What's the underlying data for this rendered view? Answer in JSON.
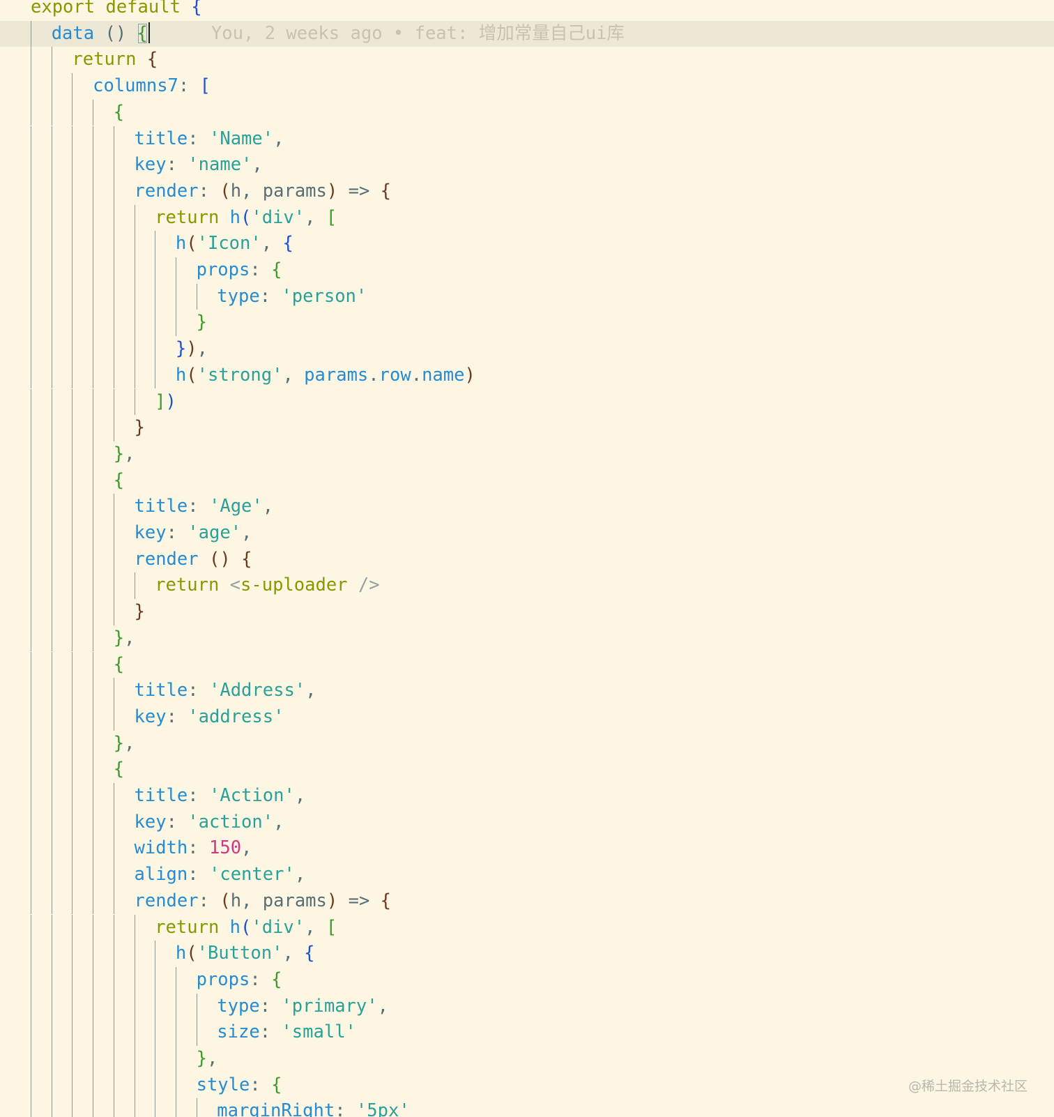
{
  "editor": {
    "current_line_index": 1,
    "lines": [
      {
        "indent": 0,
        "tokens": [
          {
            "t": "export default ",
            "c": "kw"
          },
          {
            "t": "{",
            "c": "b1"
          }
        ]
      },
      {
        "indent": 1,
        "tokens": [
          {
            "t": "data",
            "c": "prop"
          },
          {
            "t": " ",
            "c": "plain"
          },
          {
            "t": "()",
            "c": "paren"
          },
          {
            "t": " ",
            "c": "plain"
          },
          {
            "t": "{",
            "c": "b2",
            "hl": true
          }
        ],
        "cursor": true,
        "blame": "You, 2 weeks ago • feat: 增加常量自己ui库"
      },
      {
        "indent": 2,
        "tokens": [
          {
            "t": "return ",
            "c": "kw"
          },
          {
            "t": "{",
            "c": "b3"
          }
        ]
      },
      {
        "indent": 3,
        "tokens": [
          {
            "t": "columns7",
            "c": "prop"
          },
          {
            "t": ": ",
            "c": "plain"
          },
          {
            "t": "[",
            "c": "b1"
          }
        ]
      },
      {
        "indent": 4,
        "tokens": [
          {
            "t": "{",
            "c": "b2"
          }
        ]
      },
      {
        "indent": 5,
        "tokens": [
          {
            "t": "title",
            "c": "prop"
          },
          {
            "t": ": ",
            "c": "plain"
          },
          {
            "t": "'Name'",
            "c": "str"
          },
          {
            "t": ",",
            "c": "plain"
          }
        ]
      },
      {
        "indent": 5,
        "tokens": [
          {
            "t": "key",
            "c": "prop"
          },
          {
            "t": ": ",
            "c": "plain"
          },
          {
            "t": "'name'",
            "c": "str"
          },
          {
            "t": ",",
            "c": "plain"
          }
        ]
      },
      {
        "indent": 5,
        "tokens": [
          {
            "t": "render",
            "c": "prop"
          },
          {
            "t": ": ",
            "c": "plain"
          },
          {
            "t": "(",
            "c": "b3"
          },
          {
            "t": "h, params",
            "c": "plain"
          },
          {
            "t": ")",
            "c": "b3"
          },
          {
            "t": " => ",
            "c": "plain"
          },
          {
            "t": "{",
            "c": "b3"
          }
        ]
      },
      {
        "indent": 6,
        "tokens": [
          {
            "t": "return ",
            "c": "kw"
          },
          {
            "t": "h",
            "c": "prop"
          },
          {
            "t": "(",
            "c": "b1"
          },
          {
            "t": "'div'",
            "c": "str"
          },
          {
            "t": ", ",
            "c": "plain"
          },
          {
            "t": "[",
            "c": "b2"
          }
        ]
      },
      {
        "indent": 7,
        "tokens": [
          {
            "t": "h",
            "c": "prop"
          },
          {
            "t": "(",
            "c": "b3"
          },
          {
            "t": "'Icon'",
            "c": "str"
          },
          {
            "t": ", ",
            "c": "plain"
          },
          {
            "t": "{",
            "c": "b1"
          }
        ]
      },
      {
        "indent": 8,
        "tokens": [
          {
            "t": "props",
            "c": "prop"
          },
          {
            "t": ": ",
            "c": "plain"
          },
          {
            "t": "{",
            "c": "b2"
          }
        ]
      },
      {
        "indent": 9,
        "tokens": [
          {
            "t": "type",
            "c": "prop"
          },
          {
            "t": ": ",
            "c": "plain"
          },
          {
            "t": "'person'",
            "c": "str"
          }
        ]
      },
      {
        "indent": 8,
        "tokens": [
          {
            "t": "}",
            "c": "b2"
          }
        ]
      },
      {
        "indent": 7,
        "tokens": [
          {
            "t": "}",
            "c": "b1"
          },
          {
            "t": ")",
            "c": "b3"
          },
          {
            "t": ",",
            "c": "plain"
          }
        ]
      },
      {
        "indent": 7,
        "tokens": [
          {
            "t": "h",
            "c": "prop"
          },
          {
            "t": "(",
            "c": "b3"
          },
          {
            "t": "'strong'",
            "c": "str"
          },
          {
            "t": ", ",
            "c": "plain"
          },
          {
            "t": "params",
            "c": "prop"
          },
          {
            "t": ".",
            "c": "plain"
          },
          {
            "t": "row",
            "c": "prop"
          },
          {
            "t": ".",
            "c": "plain"
          },
          {
            "t": "name",
            "c": "prop"
          },
          {
            "t": ")",
            "c": "b3"
          }
        ]
      },
      {
        "indent": 6,
        "tokens": [
          {
            "t": "]",
            "c": "b2"
          },
          {
            "t": ")",
            "c": "b1"
          }
        ]
      },
      {
        "indent": 5,
        "tokens": [
          {
            "t": "}",
            "c": "b3"
          }
        ]
      },
      {
        "indent": 4,
        "tokens": [
          {
            "t": "}",
            "c": "b2"
          },
          {
            "t": ",",
            "c": "plain"
          }
        ]
      },
      {
        "indent": 4,
        "tokens": [
          {
            "t": "{",
            "c": "b2"
          }
        ]
      },
      {
        "indent": 5,
        "tokens": [
          {
            "t": "title",
            "c": "prop"
          },
          {
            "t": ": ",
            "c": "plain"
          },
          {
            "t": "'Age'",
            "c": "str"
          },
          {
            "t": ",",
            "c": "plain"
          }
        ]
      },
      {
        "indent": 5,
        "tokens": [
          {
            "t": "key",
            "c": "prop"
          },
          {
            "t": ": ",
            "c": "plain"
          },
          {
            "t": "'age'",
            "c": "str"
          },
          {
            "t": ",",
            "c": "plain"
          }
        ]
      },
      {
        "indent": 5,
        "tokens": [
          {
            "t": "render",
            "c": "prop"
          },
          {
            "t": " ",
            "c": "plain"
          },
          {
            "t": "()",
            "c": "b3"
          },
          {
            "t": " ",
            "c": "plain"
          },
          {
            "t": "{",
            "c": "b3"
          }
        ]
      },
      {
        "indent": 6,
        "tokens": [
          {
            "t": "return ",
            "c": "kw"
          },
          {
            "t": "<",
            "c": "tagp"
          },
          {
            "t": "s-uploader",
            "c": "tag"
          },
          {
            "t": " />",
            "c": "tagp"
          }
        ]
      },
      {
        "indent": 5,
        "tokens": [
          {
            "t": "}",
            "c": "b3"
          }
        ]
      },
      {
        "indent": 4,
        "tokens": [
          {
            "t": "}",
            "c": "b2"
          },
          {
            "t": ",",
            "c": "plain"
          }
        ]
      },
      {
        "indent": 4,
        "tokens": [
          {
            "t": "{",
            "c": "b2"
          }
        ]
      },
      {
        "indent": 5,
        "tokens": [
          {
            "t": "title",
            "c": "prop"
          },
          {
            "t": ": ",
            "c": "plain"
          },
          {
            "t": "'Address'",
            "c": "str"
          },
          {
            "t": ",",
            "c": "plain"
          }
        ]
      },
      {
        "indent": 5,
        "tokens": [
          {
            "t": "key",
            "c": "prop"
          },
          {
            "t": ": ",
            "c": "plain"
          },
          {
            "t": "'address'",
            "c": "str"
          }
        ]
      },
      {
        "indent": 4,
        "tokens": [
          {
            "t": "}",
            "c": "b2"
          },
          {
            "t": ",",
            "c": "plain"
          }
        ]
      },
      {
        "indent": 4,
        "tokens": [
          {
            "t": "{",
            "c": "b2"
          }
        ]
      },
      {
        "indent": 5,
        "tokens": [
          {
            "t": "title",
            "c": "prop"
          },
          {
            "t": ": ",
            "c": "plain"
          },
          {
            "t": "'Action'",
            "c": "str"
          },
          {
            "t": ",",
            "c": "plain"
          }
        ]
      },
      {
        "indent": 5,
        "tokens": [
          {
            "t": "key",
            "c": "prop"
          },
          {
            "t": ": ",
            "c": "plain"
          },
          {
            "t": "'action'",
            "c": "str"
          },
          {
            "t": ",",
            "c": "plain"
          }
        ]
      },
      {
        "indent": 5,
        "tokens": [
          {
            "t": "width",
            "c": "prop"
          },
          {
            "t": ": ",
            "c": "plain"
          },
          {
            "t": "150",
            "c": "num"
          },
          {
            "t": ",",
            "c": "plain"
          }
        ]
      },
      {
        "indent": 5,
        "tokens": [
          {
            "t": "align",
            "c": "prop"
          },
          {
            "t": ": ",
            "c": "plain"
          },
          {
            "t": "'center'",
            "c": "str"
          },
          {
            "t": ",",
            "c": "plain"
          }
        ]
      },
      {
        "indent": 5,
        "tokens": [
          {
            "t": "render",
            "c": "prop"
          },
          {
            "t": ": ",
            "c": "plain"
          },
          {
            "t": "(",
            "c": "b3"
          },
          {
            "t": "h, params",
            "c": "plain"
          },
          {
            "t": ")",
            "c": "b3"
          },
          {
            "t": " => ",
            "c": "plain"
          },
          {
            "t": "{",
            "c": "b3"
          }
        ]
      },
      {
        "indent": 6,
        "tokens": [
          {
            "t": "return ",
            "c": "kw"
          },
          {
            "t": "h",
            "c": "prop"
          },
          {
            "t": "(",
            "c": "b1"
          },
          {
            "t": "'div'",
            "c": "str"
          },
          {
            "t": ", ",
            "c": "plain"
          },
          {
            "t": "[",
            "c": "b2"
          }
        ]
      },
      {
        "indent": 7,
        "tokens": [
          {
            "t": "h",
            "c": "prop"
          },
          {
            "t": "(",
            "c": "b3"
          },
          {
            "t": "'Button'",
            "c": "str"
          },
          {
            "t": ", ",
            "c": "plain"
          },
          {
            "t": "{",
            "c": "b1"
          }
        ]
      },
      {
        "indent": 8,
        "tokens": [
          {
            "t": "props",
            "c": "prop"
          },
          {
            "t": ": ",
            "c": "plain"
          },
          {
            "t": "{",
            "c": "b2"
          }
        ]
      },
      {
        "indent": 9,
        "tokens": [
          {
            "t": "type",
            "c": "prop"
          },
          {
            "t": ": ",
            "c": "plain"
          },
          {
            "t": "'primary'",
            "c": "str"
          },
          {
            "t": ",",
            "c": "plain"
          }
        ]
      },
      {
        "indent": 9,
        "tokens": [
          {
            "t": "size",
            "c": "prop"
          },
          {
            "t": ": ",
            "c": "plain"
          },
          {
            "t": "'small'",
            "c": "str"
          }
        ]
      },
      {
        "indent": 8,
        "tokens": [
          {
            "t": "}",
            "c": "b2"
          },
          {
            "t": ",",
            "c": "plain"
          }
        ]
      },
      {
        "indent": 8,
        "tokens": [
          {
            "t": "style",
            "c": "prop"
          },
          {
            "t": ": ",
            "c": "plain"
          },
          {
            "t": "{",
            "c": "b2"
          }
        ]
      },
      {
        "indent": 9,
        "tokens": [
          {
            "t": "marginRight",
            "c": "prop"
          },
          {
            "t": ": ",
            "c": "plain"
          },
          {
            "t": "'5px'",
            "c": "str"
          }
        ]
      }
    ]
  },
  "colors": {
    "background": "#fdf6e3",
    "current_line": "#ede8d6",
    "kw": "#859900",
    "prop": "#268bd2",
    "str": "#2aa198",
    "num": "#d33682",
    "plain": "#586e75",
    "paren": "#586e75",
    "b1": "#1f4fd6",
    "b2": "#3e9a2c",
    "b3": "#6b3a1e",
    "tag": "#859900",
    "tagp": "#93a1a1",
    "guide": "#8f988f",
    "blame": "#c7c2b2"
  },
  "watermark": "@稀土掘金技术社区"
}
